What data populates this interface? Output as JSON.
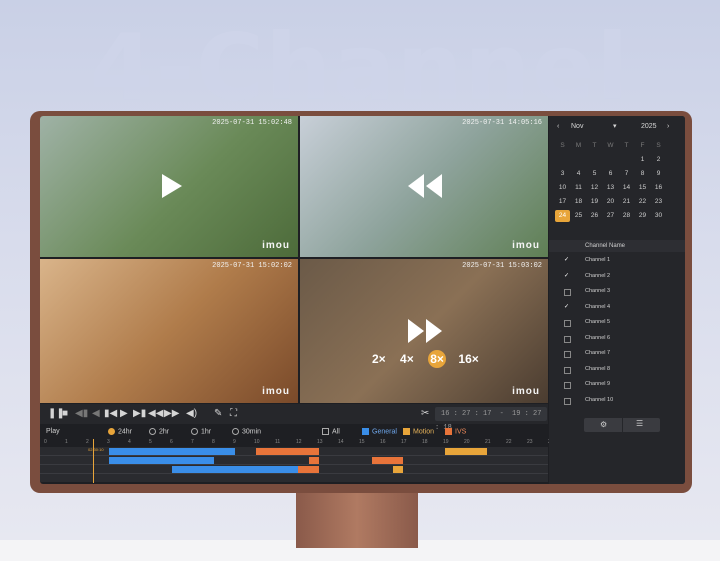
{
  "headline": "4-Channel",
  "tiles": [
    {
      "timestamp": "2025-07-31 15:02:48",
      "brand": "imou",
      "overlay": "play"
    },
    {
      "timestamp": "2025-07-31 14:05:16",
      "brand": "imou",
      "overlay": "rewind"
    },
    {
      "timestamp": "2025-07-31 15:02:02",
      "brand": "imou",
      "overlay": "none"
    },
    {
      "timestamp": "2025-07-31 15:03:02",
      "brand": "imou",
      "overlay": "fast-forward"
    }
  ],
  "speeds": [
    "2×",
    "4×",
    "8×",
    "16×"
  ],
  "speed_selected": "8×",
  "controls": {
    "icons": [
      "pause-icon",
      "stop-icon",
      "prev-frame-icon",
      "slow-icon",
      "step-back-icon",
      "step-forward-icon",
      "fast-icon",
      "next-frame-icon",
      "volume-icon",
      "pin-icon",
      "fullscreen-icon",
      "cut-icon"
    ],
    "time_from": "16 : 27 : 17",
    "time_sep": "-",
    "time_to": "19 : 27 : 18"
  },
  "filter": {
    "play_label": "Play",
    "ranges": [
      "24hr",
      "2hr",
      "1hr",
      "30min"
    ],
    "range_selected": "24hr",
    "types": [
      {
        "label": "All",
        "checked": false,
        "color": "#aaaaaa"
      },
      {
        "label": "General",
        "checked": true,
        "color": "#3a8ee8"
      },
      {
        "label": "Motion",
        "checked": true,
        "color": "#e8a53a"
      },
      {
        "label": "IVS",
        "checked": true,
        "color": "#e8743a"
      }
    ]
  },
  "timeline_hours": [
    "0",
    "1",
    "2",
    "3",
    "4",
    "5",
    "6",
    "7",
    "8",
    "9",
    "10",
    "11",
    "12",
    "13",
    "14",
    "15",
    "16",
    "17",
    "18",
    "19",
    "20",
    "21",
    "22",
    "23",
    "24"
  ],
  "cursor_label": "02:30:10",
  "calendar": {
    "month": "Nov",
    "year": "2025",
    "weekdays": [
      "S",
      "M",
      "T",
      "W",
      "T",
      "F",
      "S"
    ],
    "days": [
      [
        "",
        "",
        "",
        "",
        "",
        "1",
        "2"
      ],
      [
        "3",
        "4",
        "5",
        "6",
        "7",
        "8",
        "9"
      ],
      [
        "10",
        "11",
        "12",
        "13",
        "14",
        "15",
        "16"
      ],
      [
        "17",
        "18",
        "19",
        "20",
        "21",
        "22",
        "23"
      ],
      [
        "24",
        "25",
        "26",
        "27",
        "28",
        "29",
        "30"
      ]
    ],
    "selected_day": "24"
  },
  "channels": {
    "header": "Channel Name",
    "items": [
      {
        "name": "Channel 1",
        "checked": true
      },
      {
        "name": "Channel 2",
        "checked": true
      },
      {
        "name": "Channel 3",
        "checked": false
      },
      {
        "name": "Channel 4",
        "checked": true
      },
      {
        "name": "Channel 5",
        "checked": false
      },
      {
        "name": "Channel 6",
        "checked": false
      },
      {
        "name": "Channel 7",
        "checked": false
      },
      {
        "name": "Channel 8",
        "checked": false
      },
      {
        "name": "Channel 9",
        "checked": false
      },
      {
        "name": "Channel 10",
        "checked": false
      }
    ]
  },
  "colors": {
    "accent": "#e8a53a",
    "general": "#3a8ee8",
    "ivs": "#e8743a",
    "panel": "#25262a"
  }
}
